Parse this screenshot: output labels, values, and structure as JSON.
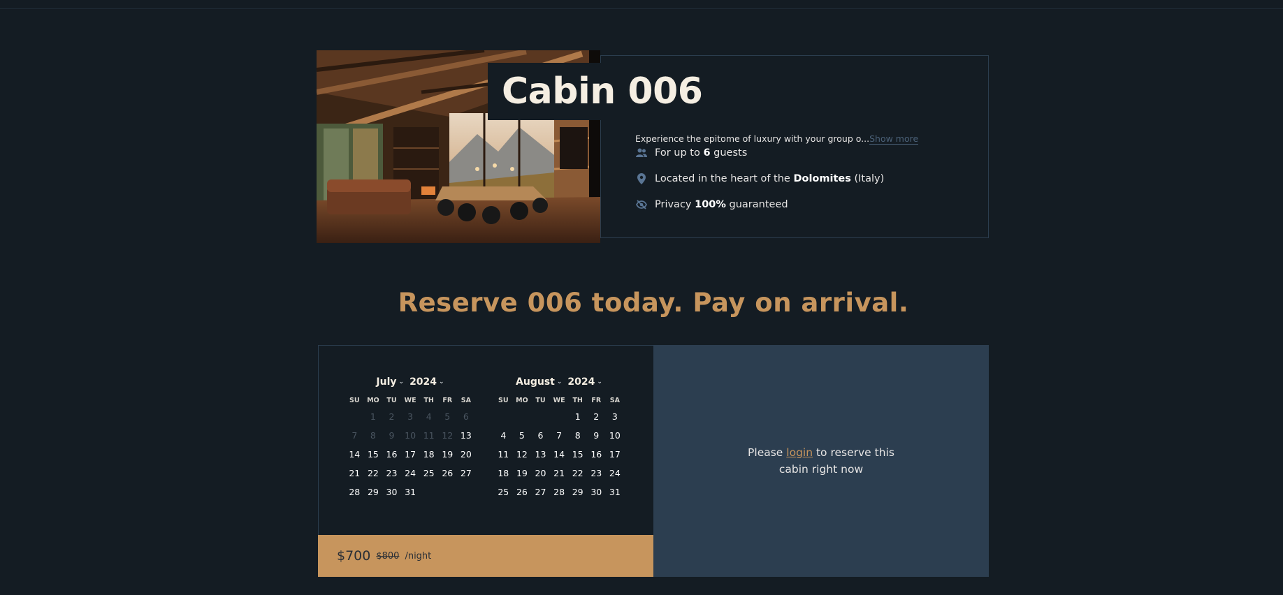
{
  "cabin": {
    "title": "Cabin 006",
    "description": "Experience the epitome of luxury with your group o...",
    "show_more": "Show more",
    "features": [
      {
        "icon": "users-icon",
        "pre": "For up to ",
        "bold": "6",
        "post": " guests"
      },
      {
        "icon": "map-pin-icon",
        "pre": "Located in the heart of the ",
        "bold": "Dolomites",
        "post": " (Italy)"
      },
      {
        "icon": "eye-slash-icon",
        "pre": "Privacy ",
        "bold": "100%",
        "post": " guaranteed"
      }
    ]
  },
  "reserve_heading": "Reserve 006 today. Pay on arrival.",
  "calendar": {
    "weekdays": [
      "SU",
      "MO",
      "TU",
      "WE",
      "TH",
      "FR",
      "SA"
    ],
    "months": [
      {
        "month": "July",
        "year": "2024",
        "leading_blanks": 1,
        "days": 31,
        "disabled_until": 12
      },
      {
        "month": "August",
        "year": "2024",
        "leading_blanks": 4,
        "days": 31,
        "disabled_until": 0
      }
    ]
  },
  "price": {
    "current": "$700",
    "original": "$800",
    "unit": "/night"
  },
  "login_panel": {
    "pre": "Please ",
    "link": "login",
    "post": " to reserve this cabin right now"
  },
  "colors": {
    "background": "#141c23",
    "accent": "#c7955d",
    "panel": "#2c3e50",
    "border": "#2b3d4e"
  }
}
